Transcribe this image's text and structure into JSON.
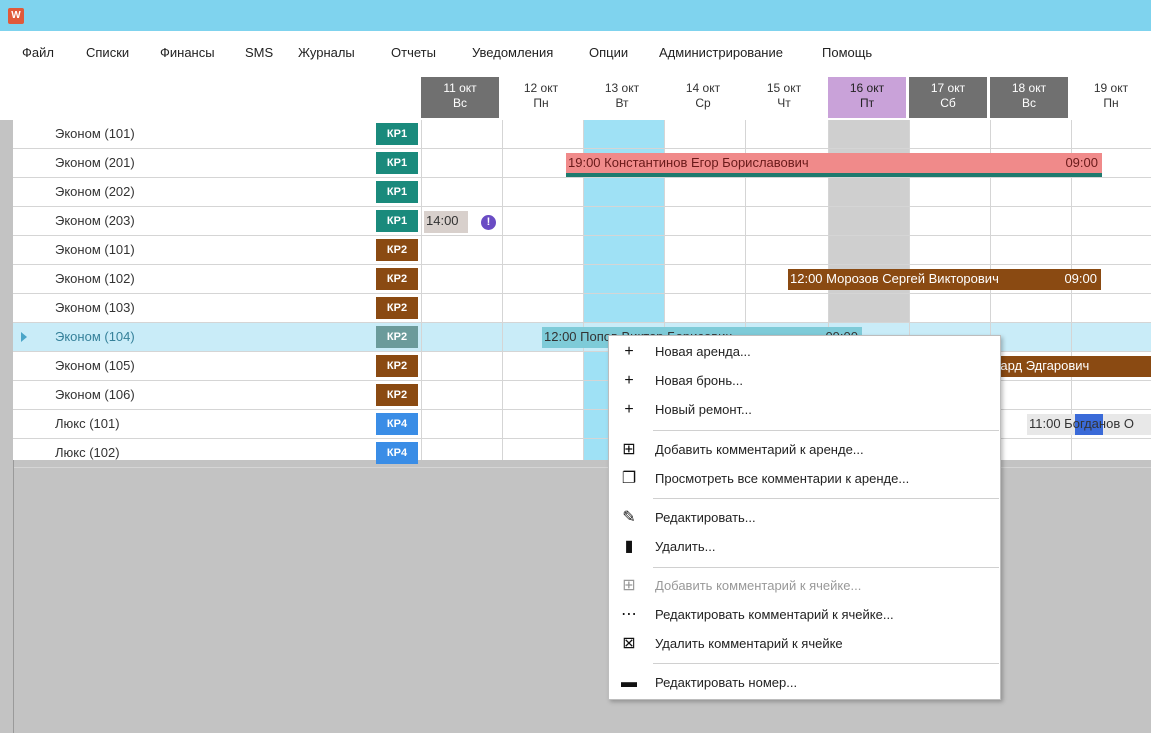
{
  "titlebar": {
    "icon_text": "W"
  },
  "menu": [
    "Файл",
    "Списки",
    "Финансы",
    "SMS",
    "Журналы",
    "Отчеты",
    "Уведомления",
    "Опции",
    "Администрирование",
    "Помощь"
  ],
  "dates": [
    {
      "d1": "11 окт",
      "d2": "Вс",
      "kind": "weekend"
    },
    {
      "d1": "12 окт",
      "d2": "Пн",
      "kind": "normal"
    },
    {
      "d1": "13 окт",
      "d2": "Вт",
      "kind": "normal"
    },
    {
      "d1": "14 окт",
      "d2": "Ср",
      "kind": "normal"
    },
    {
      "d1": "15 окт",
      "d2": "Чт",
      "kind": "normal"
    },
    {
      "d1": "16 окт",
      "d2": "Пт",
      "kind": "today"
    },
    {
      "d1": "17 окт",
      "d2": "Сб",
      "kind": "weekend"
    },
    {
      "d1": "18 окт",
      "d2": "Вс",
      "kind": "weekend"
    },
    {
      "d1": "19 окт",
      "d2": "Пн",
      "kind": "normal"
    }
  ],
  "rooms": [
    {
      "name": "Эконом (101)",
      "badge": "КР1",
      "badge_color": "#1a8a7c"
    },
    {
      "name": "Эконом (201)",
      "badge": "КР1",
      "badge_color": "#1a8a7c"
    },
    {
      "name": "Эконом (202)",
      "badge": "КР1",
      "badge_color": "#1a8a7c"
    },
    {
      "name": "Эконом (203)",
      "badge": "КР1",
      "badge_color": "#1a8a7c"
    },
    {
      "name": "Эконом (101)",
      "badge": "КР2",
      "badge_color": "#8a4a12"
    },
    {
      "name": "Эконом (102)",
      "badge": "КР2",
      "badge_color": "#8a4a12"
    },
    {
      "name": "Эконом (103)",
      "badge": "КР2",
      "badge_color": "#8a4a12"
    },
    {
      "name": "Эконом (104)",
      "badge": "КР2",
      "badge_color": "#6b9b9b",
      "selected": true
    },
    {
      "name": "Эконом (105)",
      "badge": "КР2",
      "badge_color": "#8a4a12"
    },
    {
      "name": "Эконом (106)",
      "badge": "КР2",
      "badge_color": "#8a4a12"
    },
    {
      "name": "Люкс (101)",
      "badge": "КР4",
      "badge_color": "#3a8de6"
    },
    {
      "name": "Люкс (102)",
      "badge": "КР4",
      "badge_color": "#3a8de6"
    }
  ],
  "bookings": {
    "konstantinov": {
      "text": "19:00 Константинов Егор Бориславович",
      "end": "09:00"
    },
    "checkin_203": {
      "text": "14:00"
    },
    "morozov": {
      "text": "12:00 Морозов Сергей Викторович",
      "end": "09:00"
    },
    "popov": {
      "text": "12:00 Попов Виктор Борисович",
      "end": "09:00"
    },
    "eduard": {
      "text": "уард Эдгарович"
    },
    "bogdanov": {
      "text": "11:00 Богданов О"
    }
  },
  "context_menu": [
    {
      "label": "Новая аренда...",
      "icon": "plus-icon",
      "glyph": "+"
    },
    {
      "label": "Новая бронь...",
      "icon": "plus-icon",
      "glyph": "+"
    },
    {
      "label": "Новый ремонт...",
      "icon": "plus-icon",
      "glyph": "+"
    },
    {
      "label": "Добавить комментарий к аренде...",
      "icon": "comment-add-icon",
      "glyph": "⊞"
    },
    {
      "label": "Просмотреть все комментарии к аренде...",
      "icon": "comments-icon",
      "glyph": "❐"
    },
    {
      "label": "Редактировать...",
      "icon": "pencil-icon",
      "glyph": "✎"
    },
    {
      "label": "Удалить...",
      "icon": "trash-icon",
      "glyph": "▮"
    },
    {
      "label": "Добавить комментарий к ячейке...",
      "icon": "comment-add-icon",
      "glyph": "⊞",
      "disabled": true
    },
    {
      "label": "Редактировать комментарий к ячейке...",
      "icon": "comment-edit-icon",
      "glyph": "⋯"
    },
    {
      "label": "Удалить комментарий к ячейке",
      "icon": "comment-delete-icon",
      "glyph": "⊠"
    },
    {
      "label": "Редактировать номер...",
      "icon": "bed-icon",
      "glyph": "▬"
    }
  ],
  "colors": {
    "titlebar": "#7fd3ee",
    "konstantinov_fill": "#f08a8a",
    "konstantinov_bar": "#1e7a6e",
    "brown": "#8a4a12",
    "checkin_gray": "#d8d0cc",
    "warning_purple": "#6a4cc4",
    "bogdanov_blue": "#3a6ad8"
  }
}
